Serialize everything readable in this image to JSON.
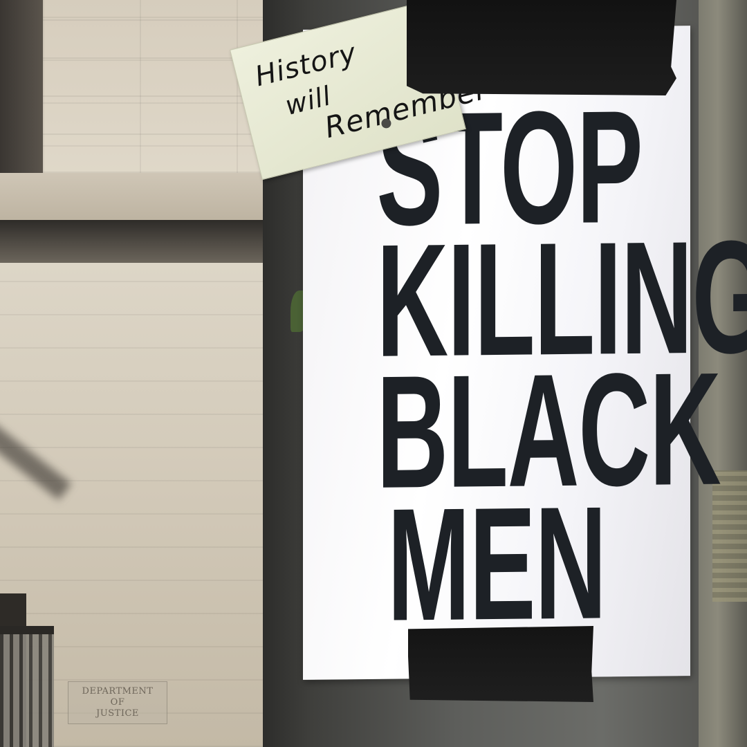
{
  "tag": {
    "line1": "History",
    "line2": "will",
    "line3": "Remember"
  },
  "sign": {
    "line1": "STOP",
    "line2": "KILLING",
    "line3": "BLACK",
    "line4": "MEN"
  },
  "plaque": {
    "line1": "DEPARTMENT",
    "line2": "OF",
    "line3": "JUSTICE"
  },
  "colors": {
    "sign_text": "#1d2126",
    "tape": "#151515",
    "tag_paper": "#e6e8d2",
    "building_stone": "#d6cdbd"
  }
}
